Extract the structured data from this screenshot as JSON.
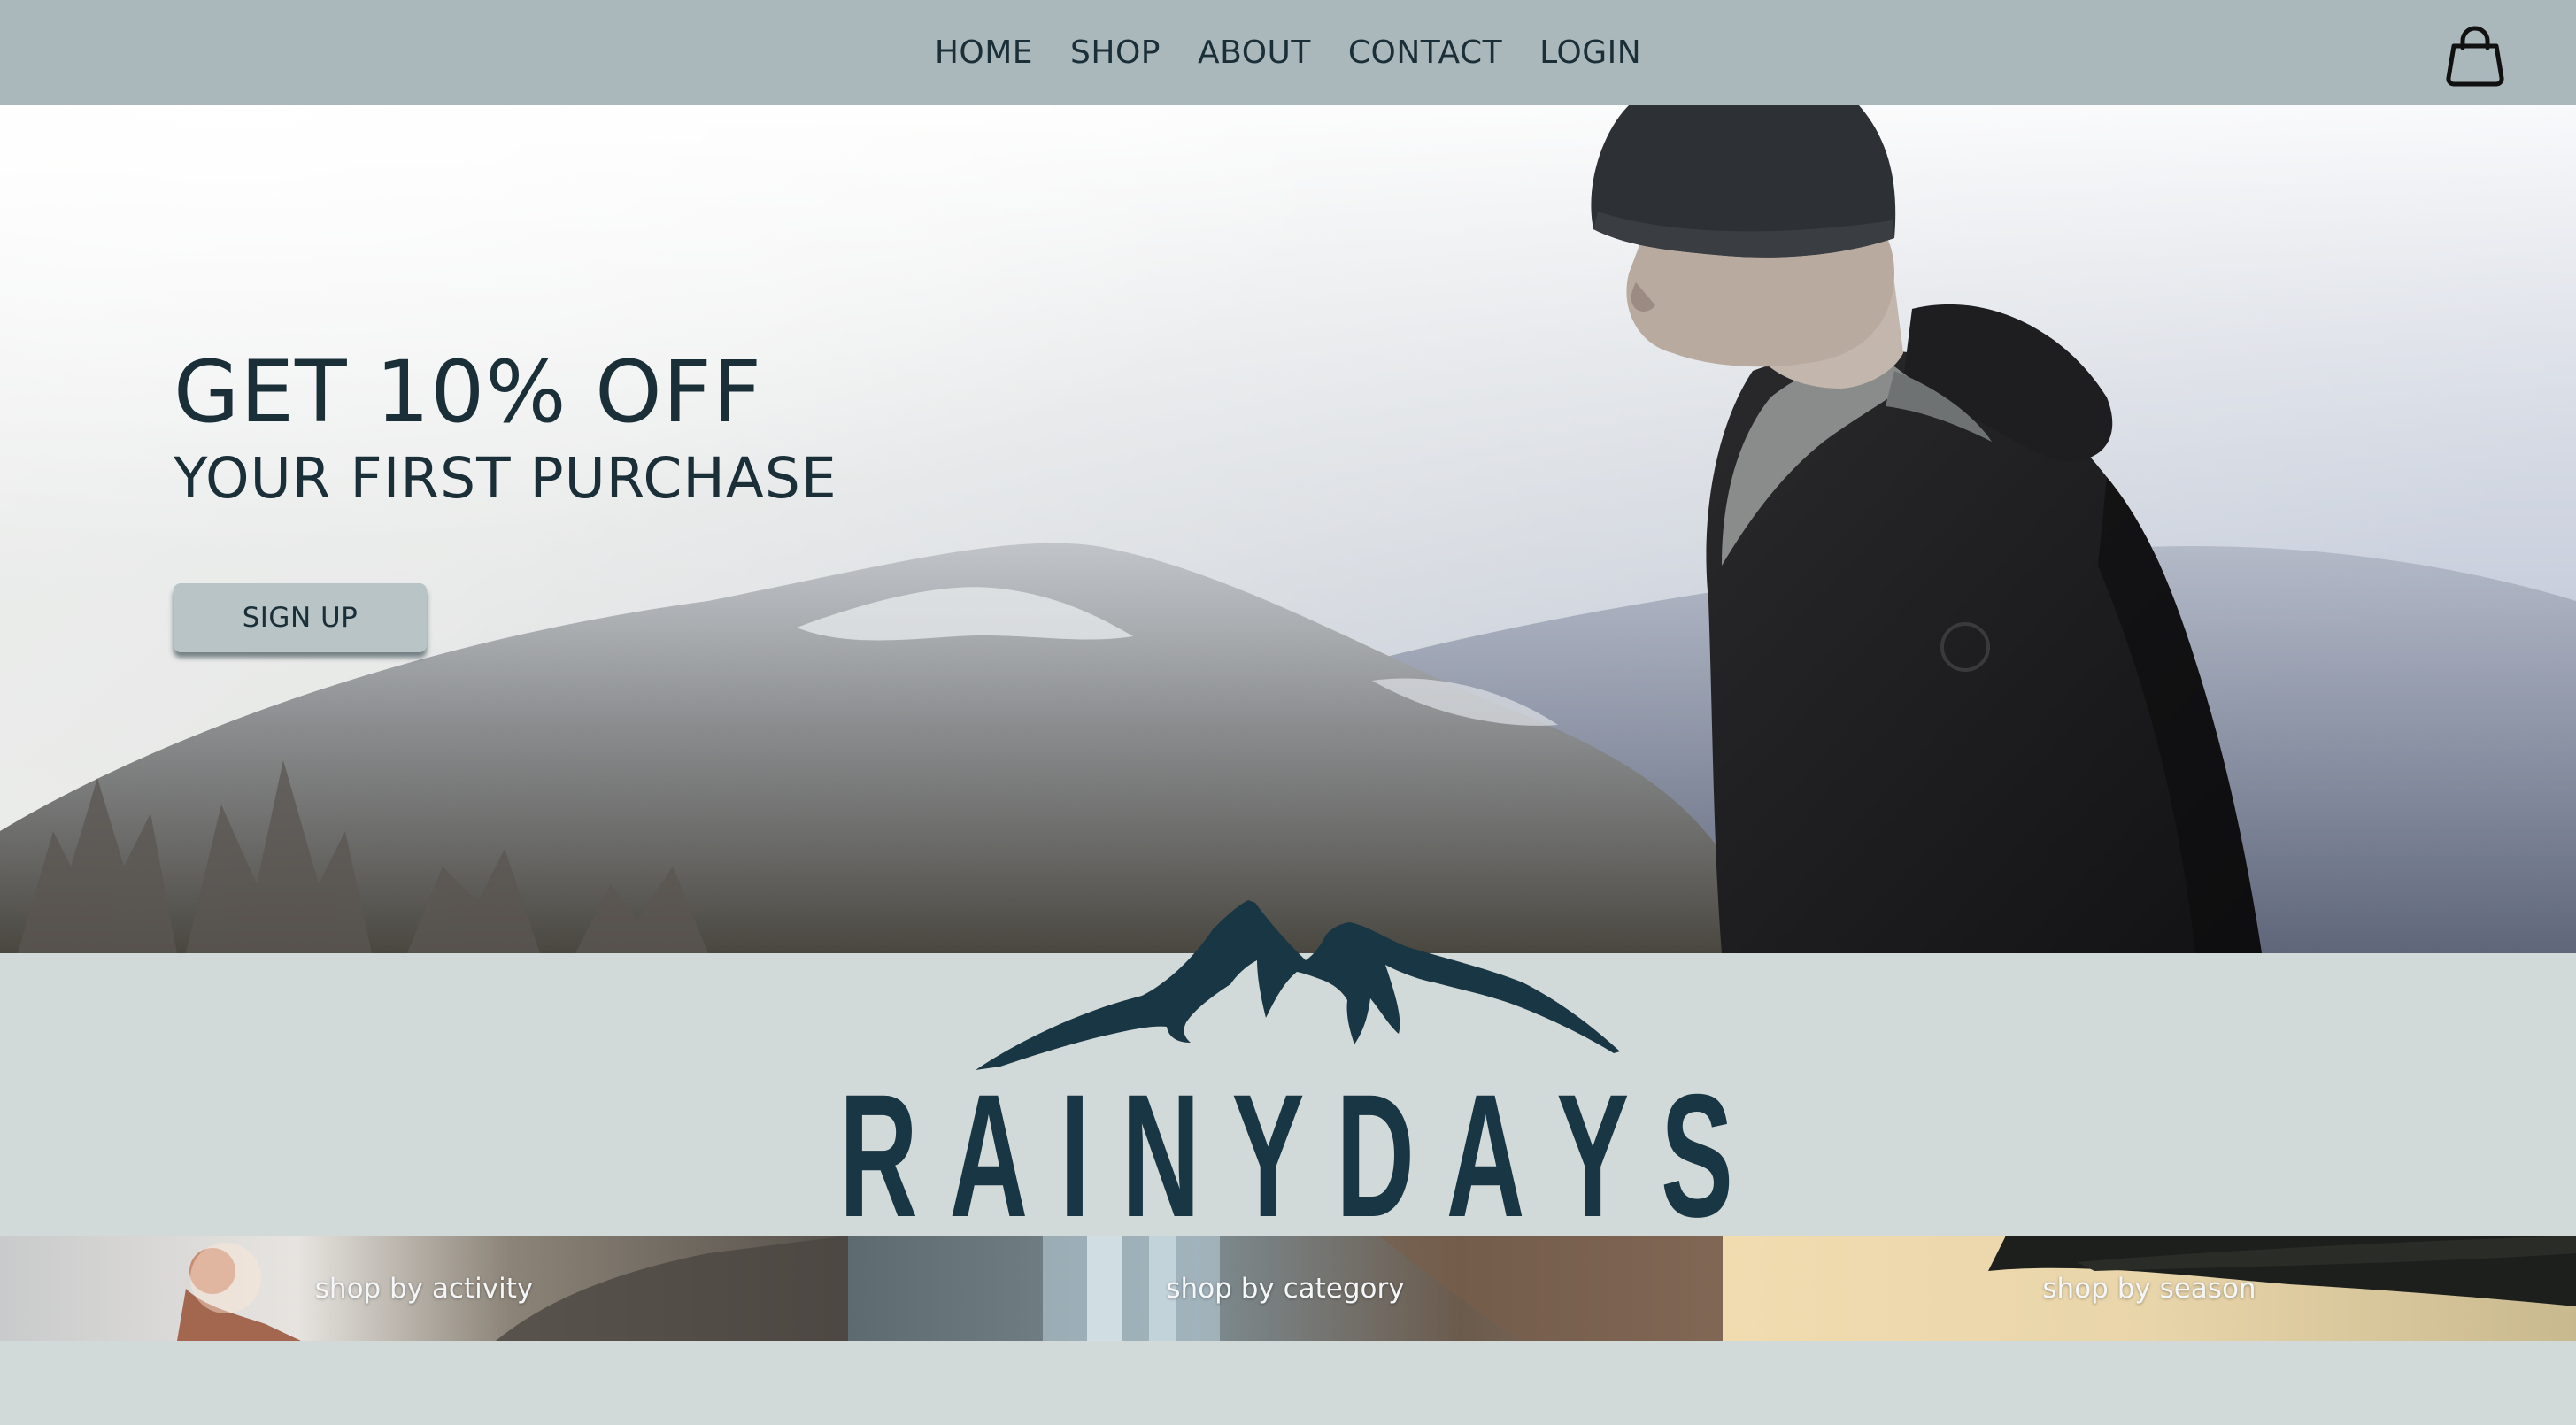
{
  "nav": {
    "links": [
      "HOME",
      "SHOP",
      "ABOUT",
      "CONTACT",
      "LOGIN"
    ],
    "cart_icon": "shopping-bag-icon"
  },
  "hero": {
    "title": "GET 10% OFF",
    "subtitle": "YOUR FIRST PURCHASE",
    "button_label": "SIGN UP"
  },
  "brand": {
    "name": "RAINYDAYS",
    "logo_icon": "mountain-logo-icon"
  },
  "tiles": [
    {
      "label": "shop by activity"
    },
    {
      "label": "shop by category"
    },
    {
      "label": "shop by season"
    }
  ],
  "colors": {
    "nav_bg": "#abb8bb",
    "page_bg": "#d2d9d9",
    "brand_dark": "#183643",
    "text_dark": "#1b2f38",
    "button_bg": "#b8c4c6"
  }
}
